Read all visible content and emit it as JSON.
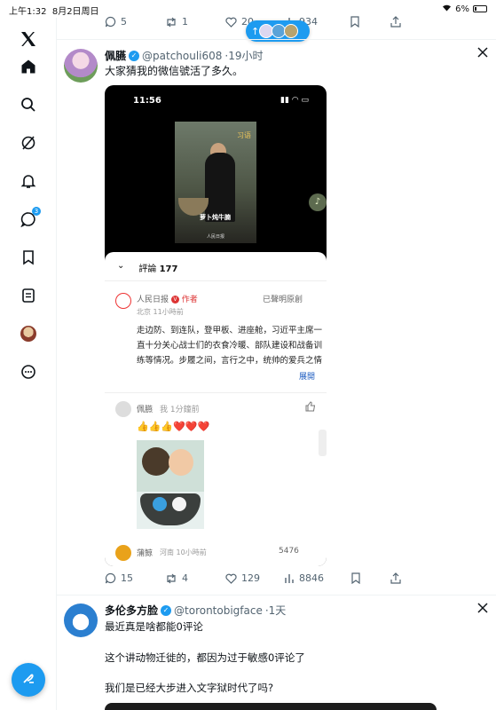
{
  "status_bar": {
    "time": "上午1:32",
    "date": "8月2日周日",
    "battery": "6%"
  },
  "nav": {
    "items": [
      {
        "name": "x-logo-icon",
        "label": "𝕏"
      },
      {
        "name": "home-icon"
      },
      {
        "name": "search-icon"
      },
      {
        "name": "grok-icon"
      },
      {
        "name": "notifications-icon"
      },
      {
        "name": "messages-icon"
      },
      {
        "name": "bookmarks-icon"
      },
      {
        "name": "lists-icon"
      },
      {
        "name": "profile-avatar-icon"
      },
      {
        "name": "more-icon"
      }
    ],
    "compose_icon": "feather-icon",
    "accent": "#1d9bf0"
  },
  "prev_tweet_actions": {
    "replies": "5",
    "reposts": "1",
    "likes": "20",
    "views": "934"
  },
  "new_posts_pill": {
    "arrow": "↑"
  },
  "tweet1": {
    "display_name": "佩臙",
    "handle": "@patchouli608",
    "time": "·19小时",
    "text": "大家猜我的微信號活了多久。",
    "screenshot": {
      "phone_time": "11:56",
      "video_caption": "萝卜炖牛腩",
      "video_watermark": "习语",
      "video_source": "人民日报",
      "comments_header": "評論",
      "comments_count": "177",
      "comments": [
        {
          "author": "人民日报",
          "tag": "作者",
          "meta": "北京 11小時前",
          "right": "已聲明原創",
          "body": "走边防、到连队，登甲板、进座舱，习近平主席一直十分关心战士们的衣食冷暖、部队建设和战备训练等情况。步履之间，言行之中，统帅的爱兵之情",
          "expand": "展開"
        },
        {
          "author": "佩臙",
          "meta": "我 1分鐘前",
          "emojis": "👍👍👍❤️❤️❤️"
        },
        {
          "author": "蒲鲸",
          "meta": "河南 10小時前",
          "right": "5476"
        }
      ]
    },
    "actions": {
      "replies": "15",
      "reposts": "4",
      "likes": "129",
      "views": "8846"
    }
  },
  "tweet2": {
    "display_name": "多伦多方脸",
    "handle": "@torontobigface",
    "time": "·1天",
    "lines": [
      "最近真是啥都能0评论",
      "这个讲动物迁徙的，都因为过于敏感0评论了",
      "我们是已经大步进入文字狱时代了吗?"
    ]
  }
}
